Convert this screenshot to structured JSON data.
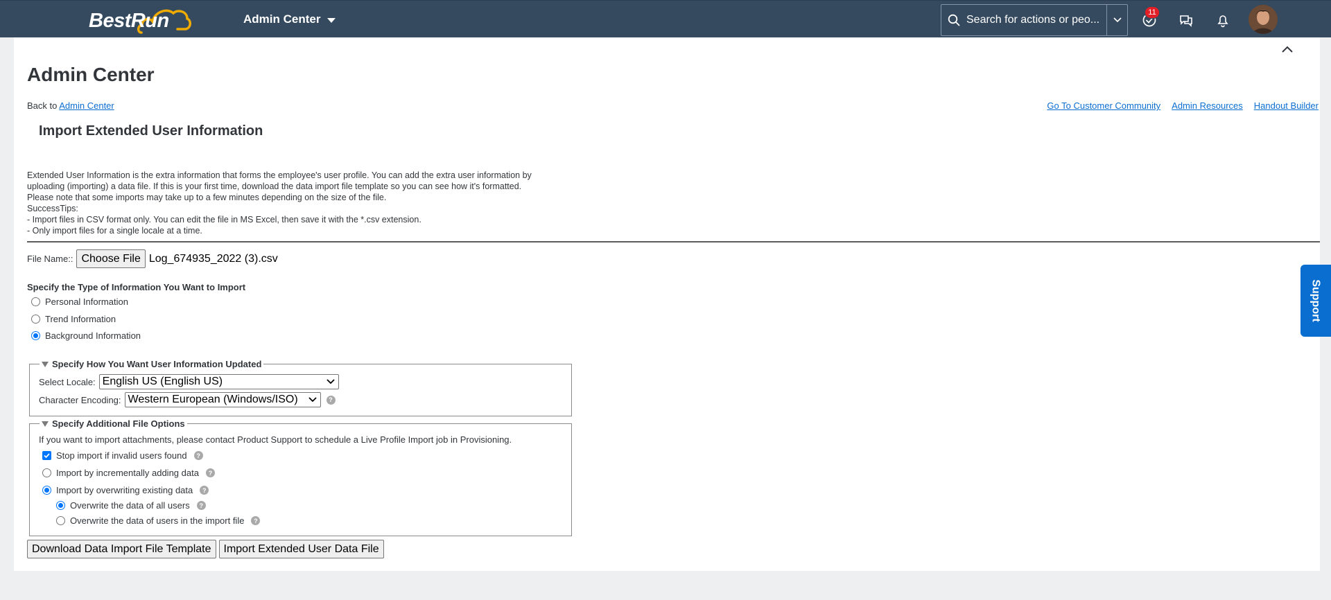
{
  "shell": {
    "logo_text": "BestRun",
    "app_title": "Admin Center",
    "search_placeholder": "Search for actions or peo...",
    "notification_count": "11"
  },
  "page": {
    "title": "Admin Center",
    "back_prefix": "Back to",
    "back_link": "Admin Center",
    "links": [
      "Go To Customer Community",
      "Admin Resources",
      "Handout Builder"
    ],
    "section_title": "Import Extended User Information",
    "description": [
      "Extended User Information is the extra information that forms the employee's user profile. You can add the extra user information by",
      "uploading (importing) a data file. If this is your first time, download the data import file template so you can see how it's formatted.",
      "Please note that some imports may take up to a few minutes depending on the size of the file.",
      "SuccessTips:",
      "- Import files in CSV format only. You can edit the file in MS Excel, then save it with the *.csv extension.",
      "- Only import files for a single locale at a time."
    ]
  },
  "file": {
    "label": "File Name::",
    "button": "Choose File",
    "selected": "Log_674935_2022 (3).csv"
  },
  "info_type": {
    "heading": "Specify the Type of Information You Want to Import",
    "options": [
      {
        "label": "Personal Information",
        "selected": false
      },
      {
        "label": "Trend Information",
        "selected": false
      },
      {
        "label": "Background Information",
        "selected": true
      }
    ]
  },
  "update_section": {
    "legend": "Specify How You Want User Information Updated",
    "locale_label": "Select Locale:",
    "locale_value": "English US (English US)",
    "encoding_label": "Character Encoding:",
    "encoding_value": "Western European (Windows/ISO)"
  },
  "file_options": {
    "legend": "Specify Additional File Options",
    "note": "If you want to import attachments, please contact Product Support to schedule a Live Profile Import job in Provisioning.",
    "stop_invalid": {
      "label": "Stop import if invalid users found",
      "checked": true
    },
    "incremental": {
      "label": "Import by incrementally adding data",
      "selected": false
    },
    "overwrite": {
      "label": "Import by overwriting existing data",
      "selected": true
    },
    "overwrite_all": {
      "label": "Overwrite the data of all users",
      "selected": true
    },
    "overwrite_import": {
      "label": "Overwrite the data of users in the import file",
      "selected": false
    }
  },
  "actions": {
    "download": "Download Data Import File Template",
    "import": "Import Extended User Data File"
  },
  "support_tab": "Support",
  "colors": {
    "shell_bg": "#354a5f",
    "link": "#0a6ed1",
    "badge": "#e21e26",
    "support": "#0a6ed1"
  }
}
